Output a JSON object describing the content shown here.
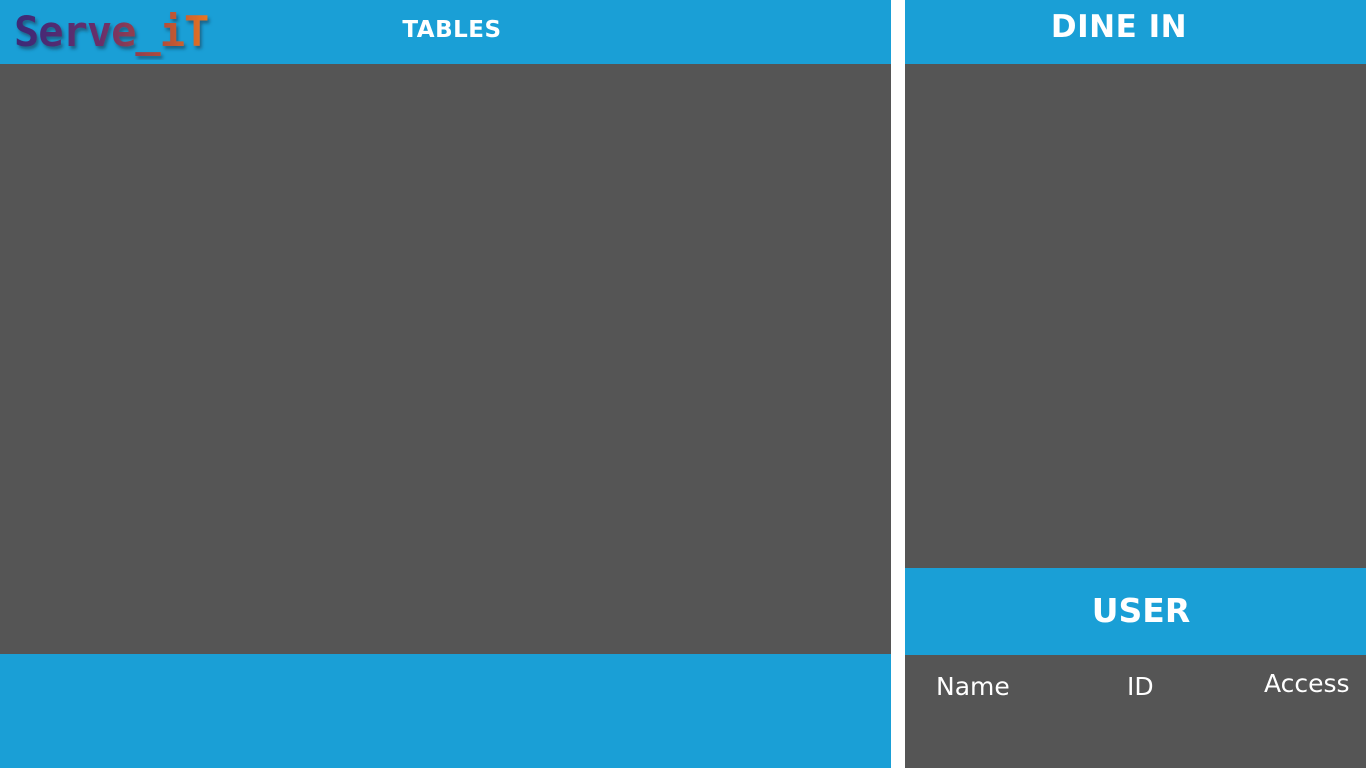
{
  "app": {
    "logo_text": "Serve_iT"
  },
  "left_panel": {
    "title": "TABLES"
  },
  "right_panel": {
    "dine_in_title": "DINE IN",
    "user_title": "USER",
    "user_columns": [
      "Name",
      "ID",
      "Access"
    ]
  },
  "colors": {
    "header_blue": "#1a9fd6",
    "panel_gray": "#555555",
    "logo_purple": "#4b2a7a",
    "logo_orange": "#e87722"
  }
}
